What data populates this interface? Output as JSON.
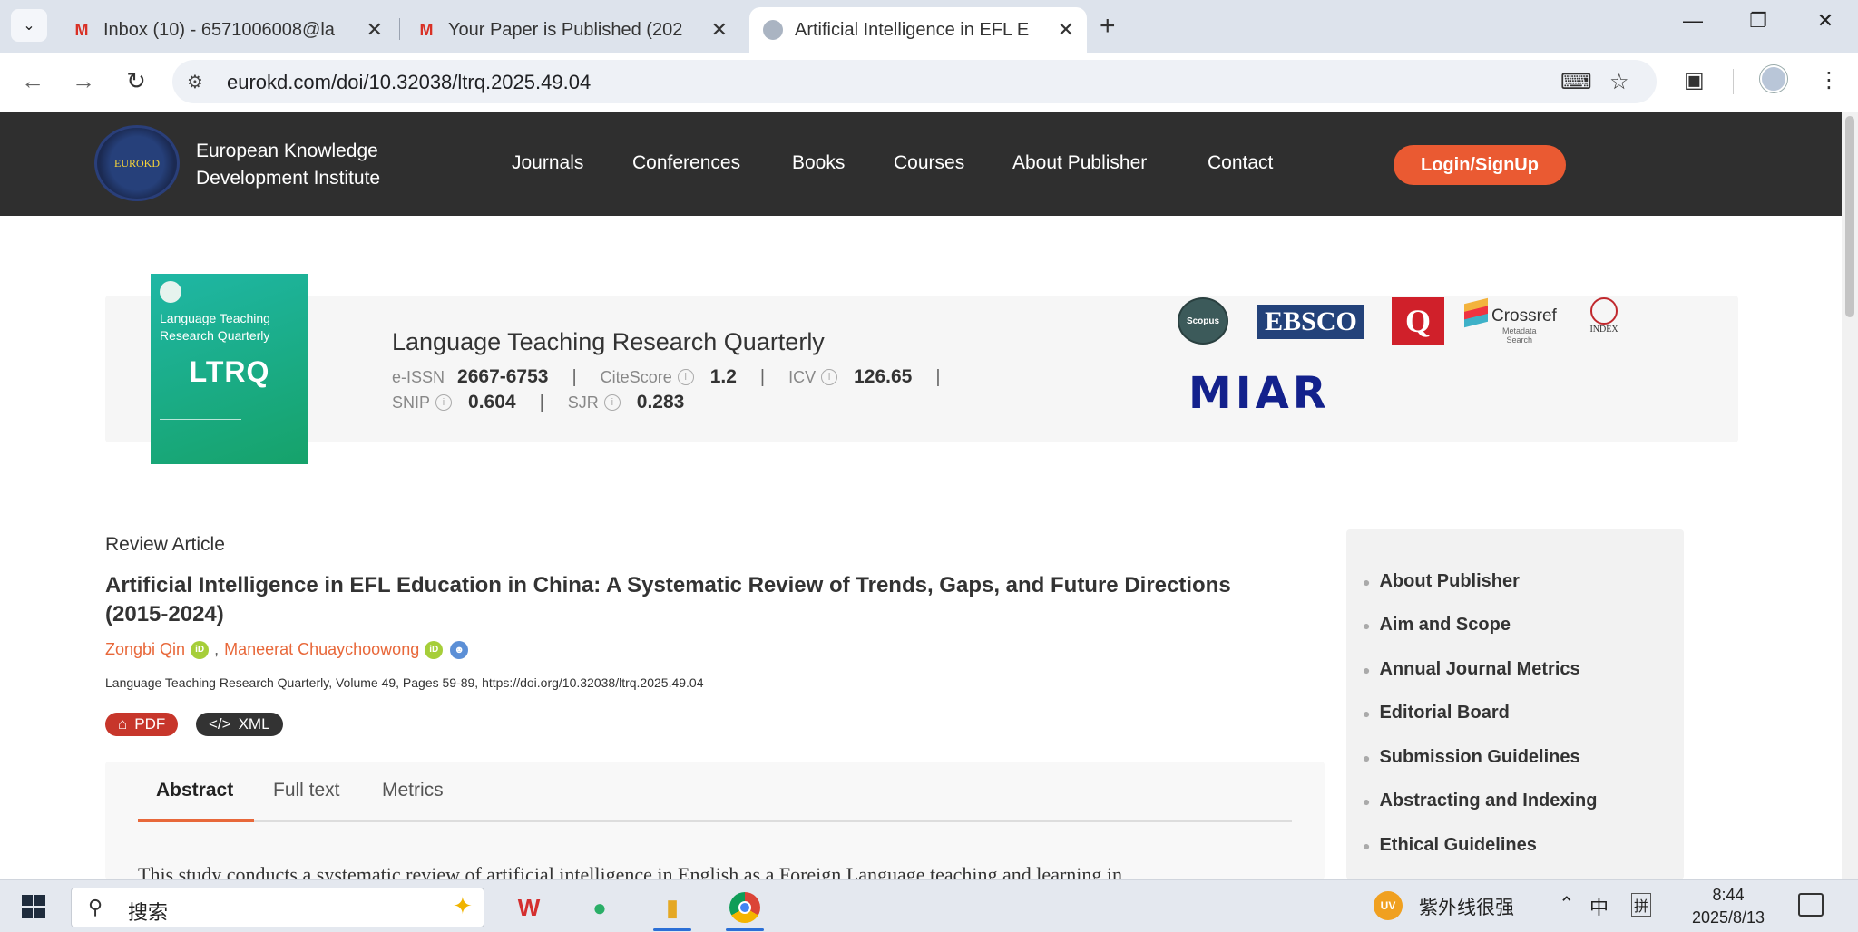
{
  "browser": {
    "tabs": [
      {
        "title": "Inbox (10) - 6571006008@la",
        "favicon": "gmail-icon",
        "active": false
      },
      {
        "title": "Your Paper is Published (202",
        "favicon": "gmail-icon",
        "active": false
      },
      {
        "title": "Artificial Intelligence in EFL E",
        "favicon": "eurokd-icon",
        "active": true
      }
    ],
    "url": "eurokd.com/doi/10.32038/ltrq.2025.49.04"
  },
  "site": {
    "brand_line1": "European Knowledge",
    "brand_line2": "Development Institute",
    "logo_text": "EUROKD",
    "nav": [
      "Journals",
      "Conferences",
      "Books",
      "Courses",
      "About Publisher",
      "Contact"
    ],
    "login_label": "Login/SignUp",
    "accent_color": "#ea5a32"
  },
  "journal": {
    "cover_subtitle_1": "Language Teaching",
    "cover_subtitle_2": "Research Quarterly",
    "cover_abbr": "LTRQ",
    "title": "Language Teaching Research Quarterly",
    "eissn_label": "e-ISSN",
    "eissn": "2667-6753",
    "citescore_label": "CiteScore",
    "citescore": "1.2",
    "icv_label": "ICV",
    "icv": "126.65",
    "snip_label": "SNIP",
    "snip": "0.604",
    "sjr_label": "SJR",
    "sjr": "0.283",
    "indexers": {
      "scopus": "Scopus",
      "ebsco": "EBSCO",
      "crossref": "Crossref",
      "crossref_sub1": "Metadata",
      "crossref_sub2": "Search",
      "index_copernicus": "INDEX",
      "miar": "MIAR"
    }
  },
  "article": {
    "type": "Review Article",
    "title": "Artificial Intelligence in EFL Education in China: A Systematic Review of Trends, Gaps, and Future Directions (2015-2024)",
    "authors": [
      "Zongbi Qin",
      "Maneerat Chuaychoowong"
    ],
    "author_separator": ",",
    "citation": "Language Teaching Research Quarterly, Volume 49, Pages 59-89, https://doi.org/10.32038/ltrq.2025.49.04",
    "pdf_label": "PDF",
    "xml_label": "XML",
    "tabs": [
      "Abstract",
      "Full text",
      "Metrics"
    ],
    "abstract_start": "This study conducts a systematic review of artificial intelligence in English as a Foreign Language teaching and learning in"
  },
  "sidebar": {
    "items": [
      "About Publisher",
      "Aim and Scope",
      "Annual Journal Metrics",
      "Editorial Board",
      "Submission Guidelines",
      "Abstracting and Indexing",
      "Ethical Guidelines"
    ]
  },
  "taskbar": {
    "search_placeholder": "搜索",
    "tray_app_name": "紫外线很强",
    "ime_mode": "中",
    "ime_layout": "拼",
    "uv_badge": "UV",
    "time": "8:44",
    "date": "2025/8/13"
  }
}
